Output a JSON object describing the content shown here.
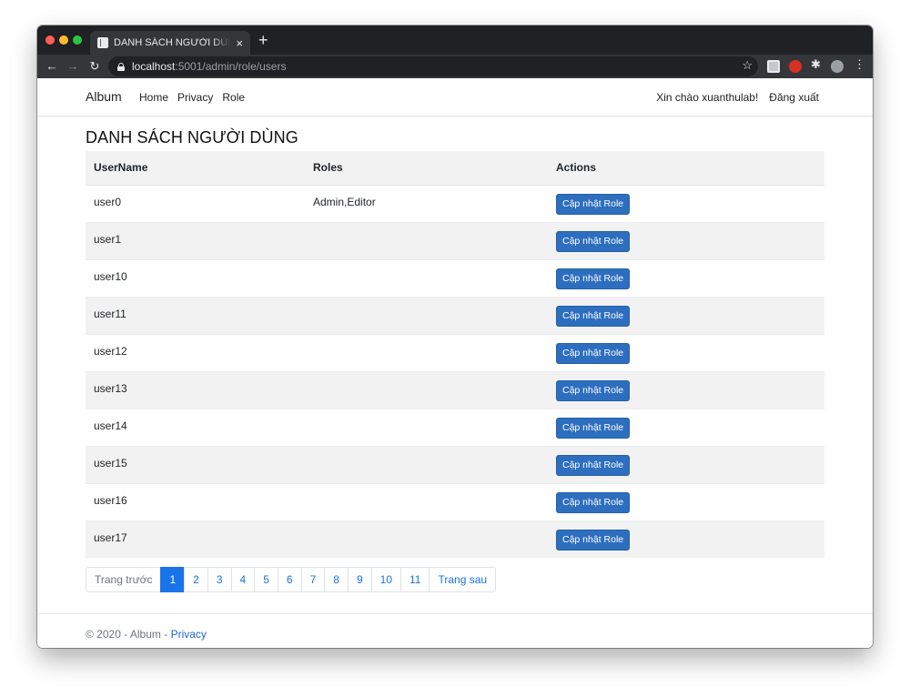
{
  "browser": {
    "tab_title": "DANH SÁCH NGƯỜI DÙNG - Album",
    "tab_close": "×",
    "new_tab": "+",
    "url_host": "localhost",
    "url_rest": ":5001/admin/role/users",
    "back": "←",
    "forward": "→",
    "reload": "↻",
    "star": "☆",
    "puzzle": "✱",
    "menu": "⋮"
  },
  "navbar": {
    "brand": "Album",
    "links": [
      "Home",
      "Privacy",
      "Role"
    ],
    "greeting": "Xin chào xuanthulab!",
    "logout": "Đăng xuất"
  },
  "page_title": "DANH SÁCH NGƯỜI DÙNG",
  "table": {
    "headers": [
      "UserName",
      "Roles",
      "Actions"
    ],
    "action_label": "Cập nhật Role",
    "rows": [
      {
        "username": "user0",
        "roles": "Admin,Editor"
      },
      {
        "username": "user1",
        "roles": ""
      },
      {
        "username": "user10",
        "roles": ""
      },
      {
        "username": "user11",
        "roles": ""
      },
      {
        "username": "user12",
        "roles": ""
      },
      {
        "username": "user13",
        "roles": ""
      },
      {
        "username": "user14",
        "roles": ""
      },
      {
        "username": "user15",
        "roles": ""
      },
      {
        "username": "user16",
        "roles": ""
      },
      {
        "username": "user17",
        "roles": ""
      }
    ]
  },
  "pagination": {
    "prev": "Trang trước",
    "pages": [
      "1",
      "2",
      "3",
      "4",
      "5",
      "6",
      "7",
      "8",
      "9",
      "10",
      "11"
    ],
    "active": "1",
    "next": "Trang sau"
  },
  "footer": {
    "text": "© 2020 - Album - ",
    "link": "Privacy"
  },
  "colors": {
    "primary_button": "#2d6ebf",
    "active_page": "#1a73e8",
    "link": "#1a66c9"
  }
}
